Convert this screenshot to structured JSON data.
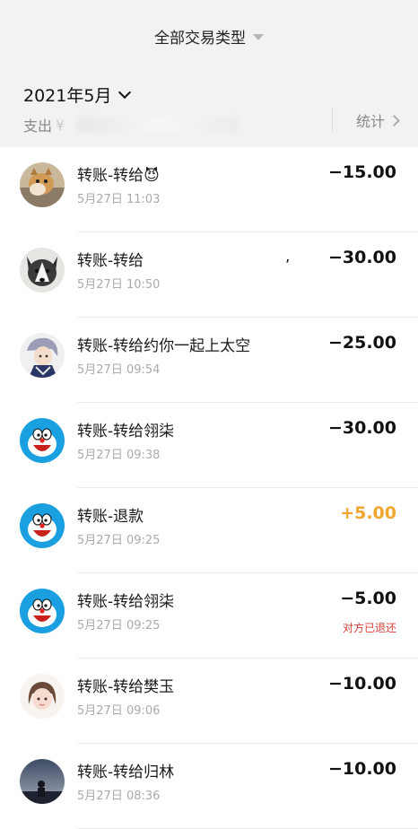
{
  "header": {
    "filter_label": "全部交易类型"
  },
  "summary": {
    "month": "2021年5月",
    "spend_label": "支出",
    "spend_prefix": "¥",
    "stats_label": "统计"
  },
  "transactions": [
    {
      "title": "转账-转给😈",
      "time": "5月27日 11:03",
      "amount": "−15.00",
      "type": "out",
      "note": ""
    },
    {
      "title": "转账-转给",
      "extra": ",",
      "time": "5月27日 10:50",
      "amount": "−30.00",
      "type": "out",
      "note": ""
    },
    {
      "title": "转账-转给约你一起上太空",
      "time": "5月27日 09:54",
      "amount": "−25.00",
      "type": "out",
      "note": ""
    },
    {
      "title": "转账-转给翎柒",
      "time": "5月27日 09:38",
      "amount": "−30.00",
      "type": "out",
      "note": ""
    },
    {
      "title": "转账-退款",
      "time": "5月27日 09:25",
      "amount": "+5.00",
      "type": "in",
      "note": ""
    },
    {
      "title": "转账-转给翎柒",
      "time": "5月27日 09:25",
      "amount": "−5.00",
      "type": "out",
      "note": "对方已退还"
    },
    {
      "title": "转账-转给樊玉",
      "time": "5月27日 09:06",
      "amount": "−10.00",
      "type": "out",
      "note": ""
    },
    {
      "title": "转账-转给归林",
      "time": "5月27日 08:36",
      "amount": "−10.00",
      "type": "out",
      "note": ""
    }
  ]
}
